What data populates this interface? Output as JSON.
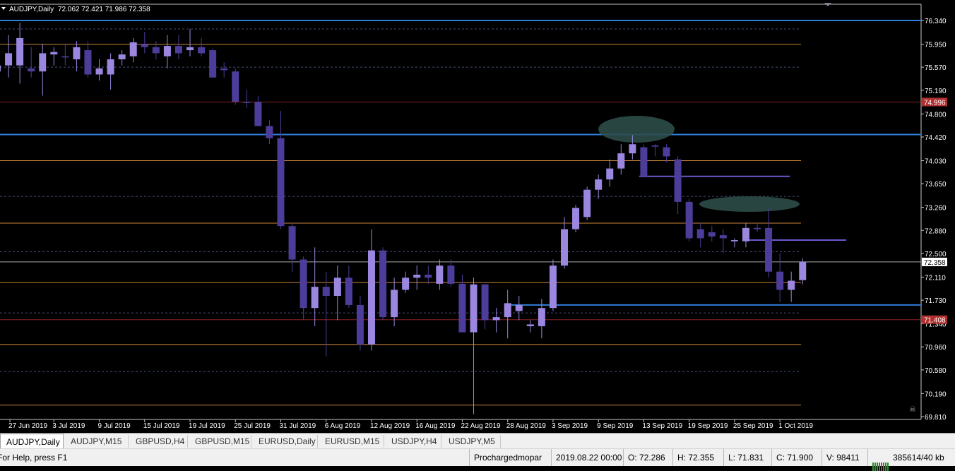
{
  "window": {
    "symbol_label": "AUDJPY,Daily",
    "ohlc_readout": "72.062 72.421 71.986 72.358"
  },
  "price_scale": {
    "ticks": [
      "76.340",
      "75.950",
      "75.570",
      "75.190",
      "74.800",
      "74.420",
      "74.030",
      "73.650",
      "73.260",
      "72.880",
      "72.500",
      "72.110",
      "71.730",
      "71.340",
      "70.960",
      "70.580",
      "70.190",
      "69.810"
    ],
    "current_price_label": "72.358",
    "alert_high_label": "74.996",
    "alert_low_label": "71.408"
  },
  "time_scale": {
    "labels": [
      "27 Jun 2019",
      "3 Jul 2019",
      "9 Jul 2019",
      "15 Jul 2019",
      "19 Jul 2019",
      "25 Jul 2019",
      "31 Jul 2019",
      "6 Aug 2019",
      "12 Aug 2019",
      "16 Aug 2019",
      "22 Aug 2019",
      "28 Aug 2019",
      "3 Sep 2019",
      "9 Sep 2019",
      "13 Sep 2019",
      "19 Sep 2019",
      "25 Sep 2019",
      "1 Oct 2019"
    ]
  },
  "chart_data": {
    "type": "candlestick",
    "title": "AUDJPY,Daily",
    "ylim": [
      69.81,
      76.34
    ],
    "up_color": "#9b86e0",
    "down_color": "#4d3d9a",
    "candles": [
      {
        "o": 75.5,
        "h": 75.9,
        "l": 75.2,
        "c": 75.6
      },
      {
        "o": 75.6,
        "h": 76.1,
        "l": 75.4,
        "c": 75.8
      },
      {
        "o": 75.6,
        "h": 76.3,
        "l": 75.3,
        "c": 76.05
      },
      {
        "o": 75.55,
        "h": 75.9,
        "l": 75.4,
        "c": 75.5
      },
      {
        "o": 75.5,
        "h": 75.95,
        "l": 75.1,
        "c": 75.8
      },
      {
        "o": 75.78,
        "h": 75.9,
        "l": 75.6,
        "c": 75.82
      },
      {
        "o": 75.75,
        "h": 75.95,
        "l": 75.6,
        "c": 75.73
      },
      {
        "o": 75.7,
        "h": 76.0,
        "l": 75.5,
        "c": 75.9
      },
      {
        "o": 75.85,
        "h": 76.0,
        "l": 75.4,
        "c": 75.45
      },
      {
        "o": 75.45,
        "h": 75.7,
        "l": 75.35,
        "c": 75.55
      },
      {
        "o": 75.45,
        "h": 75.8,
        "l": 75.2,
        "c": 75.7
      },
      {
        "o": 75.7,
        "h": 75.85,
        "l": 75.6,
        "c": 75.78
      },
      {
        "o": 75.75,
        "h": 76.05,
        "l": 75.65,
        "c": 75.98
      },
      {
        "o": 75.95,
        "h": 76.15,
        "l": 75.8,
        "c": 75.9
      },
      {
        "o": 75.9,
        "h": 76.0,
        "l": 75.7,
        "c": 75.8
      },
      {
        "o": 75.75,
        "h": 76.1,
        "l": 75.55,
        "c": 75.92
      },
      {
        "o": 75.92,
        "h": 76.1,
        "l": 75.7,
        "c": 75.8
      },
      {
        "o": 75.85,
        "h": 76.2,
        "l": 75.75,
        "c": 75.9
      },
      {
        "o": 75.9,
        "h": 76.05,
        "l": 75.75,
        "c": 75.8
      },
      {
        "o": 75.85,
        "h": 75.88,
        "l": 75.5,
        "c": 75.4
      },
      {
        "o": 75.55,
        "h": 75.65,
        "l": 75.4,
        "c": 75.52
      },
      {
        "o": 75.5,
        "h": 75.55,
        "l": 74.95,
        "c": 75.0
      },
      {
        "o": 75.0,
        "h": 75.2,
        "l": 74.9,
        "c": 74.98
      },
      {
        "o": 75.0,
        "h": 75.1,
        "l": 74.6,
        "c": 74.6
      },
      {
        "o": 74.6,
        "h": 74.7,
        "l": 74.3,
        "c": 74.4
      },
      {
        "o": 74.4,
        "h": 74.85,
        "l": 72.9,
        "c": 72.95
      },
      {
        "o": 72.95,
        "h": 73.0,
        "l": 72.2,
        "c": 72.4
      },
      {
        "o": 72.4,
        "h": 72.45,
        "l": 71.4,
        "c": 71.6
      },
      {
        "o": 71.6,
        "h": 72.6,
        "l": 71.3,
        "c": 71.95
      },
      {
        "o": 71.95,
        "h": 72.2,
        "l": 70.8,
        "c": 71.8
      },
      {
        "o": 71.8,
        "h": 72.3,
        "l": 71.4,
        "c": 72.1
      },
      {
        "o": 72.1,
        "h": 72.3,
        "l": 71.6,
        "c": 71.65
      },
      {
        "o": 71.65,
        "h": 71.8,
        "l": 70.9,
        "c": 71.0
      },
      {
        "o": 71.0,
        "h": 72.9,
        "l": 70.9,
        "c": 72.55
      },
      {
        "o": 72.55,
        "h": 72.6,
        "l": 71.4,
        "c": 71.45
      },
      {
        "o": 71.45,
        "h": 72.1,
        "l": 71.3,
        "c": 71.9
      },
      {
        "o": 71.9,
        "h": 72.2,
        "l": 71.85,
        "c": 72.1
      },
      {
        "o": 72.1,
        "h": 72.3,
        "l": 71.9,
        "c": 72.15
      },
      {
        "o": 72.15,
        "h": 72.3,
        "l": 72.0,
        "c": 72.1
      },
      {
        "o": 72.0,
        "h": 72.4,
        "l": 71.9,
        "c": 72.3
      },
      {
        "o": 72.3,
        "h": 72.4,
        "l": 71.95,
        "c": 72.0
      },
      {
        "o": 72.0,
        "h": 72.15,
        "l": 71.2,
        "c": 71.2
      },
      {
        "o": 71.2,
        "h": 72.1,
        "l": 69.85,
        "c": 71.99
      },
      {
        "o": 71.99,
        "h": 72.0,
        "l": 71.25,
        "c": 71.4
      },
      {
        "o": 71.4,
        "h": 71.6,
        "l": 71.2,
        "c": 71.45
      },
      {
        "o": 71.45,
        "h": 71.9,
        "l": 71.1,
        "c": 71.68
      },
      {
        "o": 71.55,
        "h": 71.8,
        "l": 71.4,
        "c": 71.65
      },
      {
        "o": 71.3,
        "h": 71.4,
        "l": 71.2,
        "c": 71.33
      },
      {
        "o": 71.3,
        "h": 71.75,
        "l": 71.1,
        "c": 71.6
      },
      {
        "o": 71.6,
        "h": 72.4,
        "l": 71.55,
        "c": 72.3
      },
      {
        "o": 72.3,
        "h": 73.1,
        "l": 72.25,
        "c": 72.9
      },
      {
        "o": 72.9,
        "h": 73.3,
        "l": 72.85,
        "c": 73.25
      },
      {
        "o": 73.1,
        "h": 73.6,
        "l": 73.05,
        "c": 73.55
      },
      {
        "o": 73.55,
        "h": 73.8,
        "l": 73.4,
        "c": 73.72
      },
      {
        "o": 73.72,
        "h": 74.05,
        "l": 73.6,
        "c": 73.9
      },
      {
        "o": 73.9,
        "h": 74.3,
        "l": 73.8,
        "c": 74.15
      },
      {
        "o": 74.15,
        "h": 74.45,
        "l": 74.05,
        "c": 74.3
      },
      {
        "o": 74.25,
        "h": 74.3,
        "l": 73.75,
        "c": 73.77
      },
      {
        "o": 74.28,
        "h": 74.3,
        "l": 74.1,
        "c": 74.26
      },
      {
        "o": 74.25,
        "h": 74.3,
        "l": 74.0,
        "c": 74.1
      },
      {
        "o": 74.05,
        "h": 74.1,
        "l": 73.15,
        "c": 73.35
      },
      {
        "o": 73.35,
        "h": 73.4,
        "l": 72.7,
        "c": 72.75
      },
      {
        "o": 72.9,
        "h": 73.0,
        "l": 72.6,
        "c": 72.75
      },
      {
        "o": 72.85,
        "h": 72.95,
        "l": 72.7,
        "c": 72.78
      },
      {
        "o": 72.8,
        "h": 72.9,
        "l": 72.5,
        "c": 72.75
      },
      {
        "o": 72.7,
        "h": 72.75,
        "l": 72.6,
        "c": 72.72
      },
      {
        "o": 72.7,
        "h": 73.0,
        "l": 72.6,
        "c": 72.92
      },
      {
        "o": 72.92,
        "h": 73.0,
        "l": 72.85,
        "c": 72.9
      },
      {
        "o": 72.92,
        "h": 73.25,
        "l": 72.1,
        "c": 72.2
      },
      {
        "o": 72.2,
        "h": 72.5,
        "l": 71.7,
        "c": 71.9
      },
      {
        "o": 71.9,
        "h": 72.2,
        "l": 71.7,
        "c": 72.05
      },
      {
        "o": 72.06,
        "h": 72.42,
        "l": 71.99,
        "c": 72.36
      }
    ]
  },
  "tabs": [
    "AUDJPY,Daily",
    "AUDJPY,M15",
    "GBPUSD,H4",
    "GBPUSD,M15",
    "EURUSD,Daily",
    "EURUSD,M15",
    "USDJPY,H4",
    "USDJPY,M5"
  ],
  "status": {
    "help_text": "For Help, press F1",
    "profile": "Prochargedmopar",
    "datetime": "2019.08.22 00:00",
    "open": "O: 72.286",
    "high": "H: 72.355",
    "low": "L: 71.831",
    "close": "C: 71.900",
    "volume": "V: 98411",
    "traffic": "385614/40 kb"
  }
}
